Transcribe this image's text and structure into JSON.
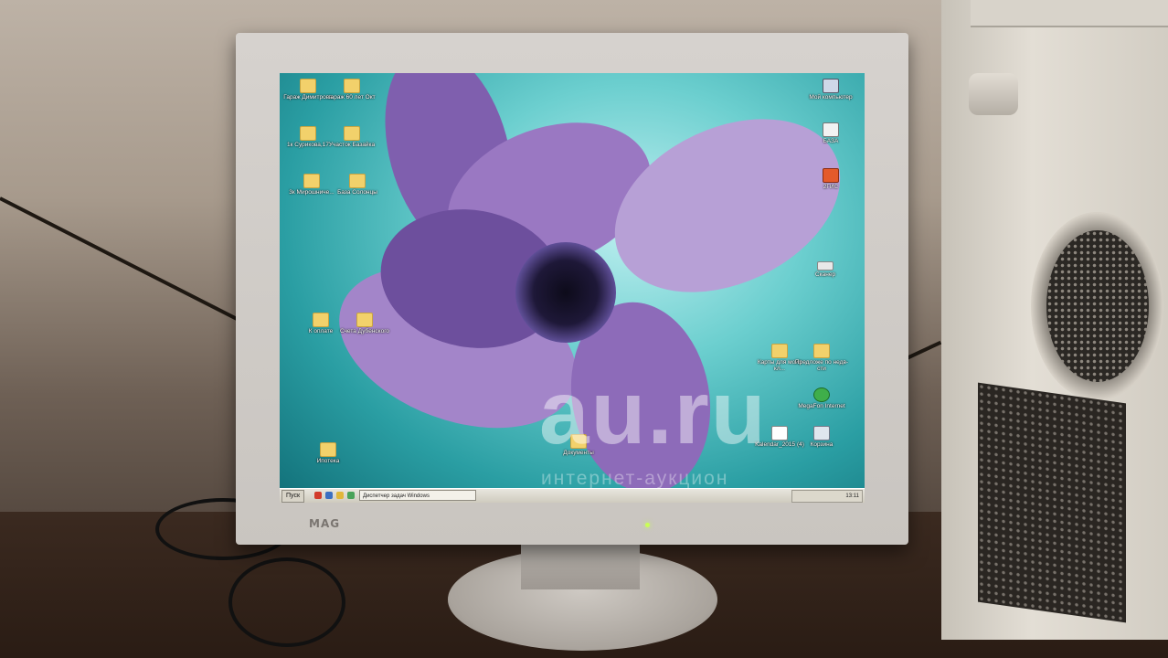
{
  "monitor": {
    "brand": "MAG"
  },
  "desktop_icons": {
    "left": [
      {
        "label": "Гараж Димитрова",
        "type": "folder"
      },
      {
        "label": "гараж 60 лет Окт",
        "type": "folder"
      },
      {
        "label": "1к Сурикова,17",
        "type": "folder"
      },
      {
        "label": "Участок Базайка",
        "type": "folder"
      },
      {
        "label": "3к Мирошниче...",
        "type": "folder"
      },
      {
        "label": "База Солонцы",
        "type": "folder"
      },
      {
        "label": "К оплате",
        "type": "folder"
      },
      {
        "label": "Счета Дубенского",
        "type": "folder"
      },
      {
        "label": "Ипотека",
        "type": "folder"
      },
      {
        "label": "Документы",
        "type": "folder"
      }
    ],
    "right": [
      {
        "label": "Мой компьютер",
        "type": "computer"
      },
      {
        "label": "БАЗА",
        "type": "app"
      },
      {
        "label": "2ГИС",
        "type": "app"
      },
      {
        "label": "Сканер",
        "type": "app"
      },
      {
        "label": "Карты для моих кл...",
        "type": "folder"
      },
      {
        "label": "Предложе по недв-сти",
        "type": "folder"
      },
      {
        "label": "MegaFon Internet",
        "type": "app"
      },
      {
        "label": "Kalendar_2015 (4)",
        "type": "document"
      },
      {
        "label": "Корзина",
        "type": "recycle-bin"
      }
    ]
  },
  "taskbar": {
    "start_label": "Пуск",
    "task_label": "Диспетчер задач Windows",
    "clock": "13:11"
  },
  "watermark": {
    "main": "au.ru",
    "sub": "интернет-аукцион"
  },
  "colors": {
    "folder": "#f2d16b",
    "petal": "#9a78c2",
    "screen_bg": "#2a9ea3"
  }
}
